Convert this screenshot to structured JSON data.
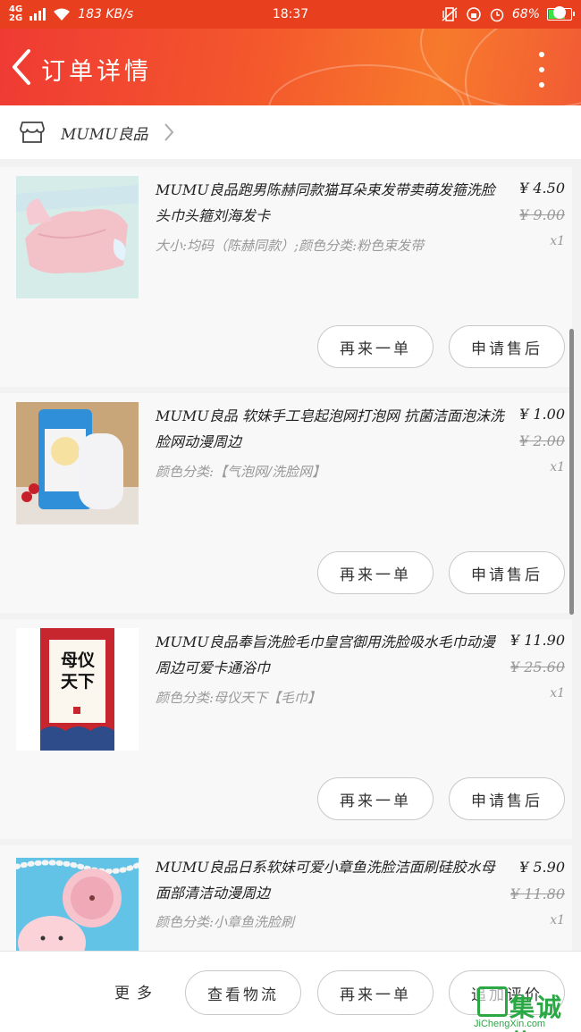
{
  "status_bar": {
    "network": "4G\n2G",
    "speed": "183 KB/s",
    "time": "18:37",
    "battery": "68%",
    "battery_level": 0.68
  },
  "header": {
    "title": "订单详情",
    "icons": [
      "back-arrow-icon",
      "more-vertical-icon"
    ],
    "accent": "#f4582c"
  },
  "shop": {
    "name": "MUMU良品",
    "icon": "store-icon"
  },
  "items": [
    {
      "title": "MUMU良品跑男陈赫同款猫耳朵束发带卖萌发箍洗脸头巾头箍刘海发卡",
      "spec": "大小:均码（陈赫同款）;颜色分类:粉色束发带",
      "price": "¥ 4.50",
      "orig_price": "¥ 9.00",
      "qty": "x1",
      "buy_again": "再来一单",
      "refund": "申请售后"
    },
    {
      "title": "MUMU良品 软妹手工皂起泡网打泡网 抗菌洁面泡沫洗脸网动漫周边",
      "spec": "颜色分类:【气泡网/洗脸网】",
      "price": "¥ 1.00",
      "orig_price": "¥ 2.00",
      "qty": "x1",
      "buy_again": "再来一单",
      "refund": "申请售后"
    },
    {
      "title": "MUMU良品奉旨洗脸毛巾皇宫御用洗脸吸水毛巾动漫周边可爱卡通浴巾",
      "spec": "颜色分类:母仪天下【毛巾】",
      "price": "¥ 11.90",
      "orig_price": "¥ 25.60",
      "qty": "x1",
      "towel_text": "母仪天下",
      "buy_again": "再来一单",
      "refund": "申请售后"
    },
    {
      "title": "MUMU良品日系软妹可爱小章鱼洗脸洁面刷硅胶水母面部清洁动漫周边",
      "spec": "颜色分类:小章鱼洗脸刷",
      "price": "¥ 5.90",
      "orig_price": "¥ 11.80",
      "qty": "x1"
    }
  ],
  "bottom": {
    "more": "更多",
    "logistics": "查看物流",
    "buy_again": "再来一单",
    "review": "追加评价"
  },
  "watermark": {
    "text": "集诚信",
    "url": "JiChengXin.com"
  }
}
